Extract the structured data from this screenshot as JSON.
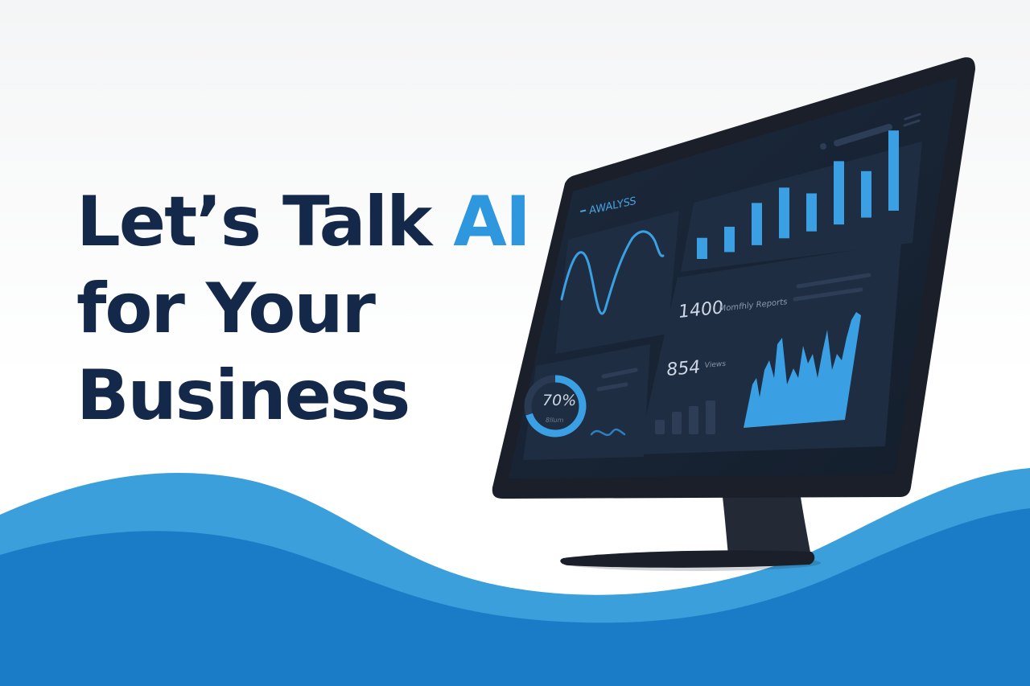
{
  "headline": {
    "line1": "Let’s Talk",
    "accent": "AI",
    "line2": "for Your",
    "line3": "Business"
  },
  "dashboard": {
    "brand": "AWALYSS",
    "donut": {
      "value_label": "70%",
      "sub_label": "8llum",
      "level": 0.7
    },
    "stat_reports": {
      "value": "1400",
      "label": "Momfhly Reports"
    },
    "stat_views": {
      "value": "854",
      "label": "Views"
    },
    "top_bar_levels": [
      0.25,
      0.3,
      0.5,
      0.6,
      0.45,
      0.75,
      0.55,
      0.95
    ]
  },
  "colors": {
    "headline": "#14284a",
    "accent": "#2f97dd",
    "dashboard_bg": "#182436",
    "panel": "#1f2d42",
    "bezel": "#1a1f29",
    "stand": "#232a36",
    "wave_light": "#3b9fdc",
    "wave_dark": "#1a7cc6"
  },
  "icons": [
    "monitor-icon",
    "wave-decoration"
  ]
}
